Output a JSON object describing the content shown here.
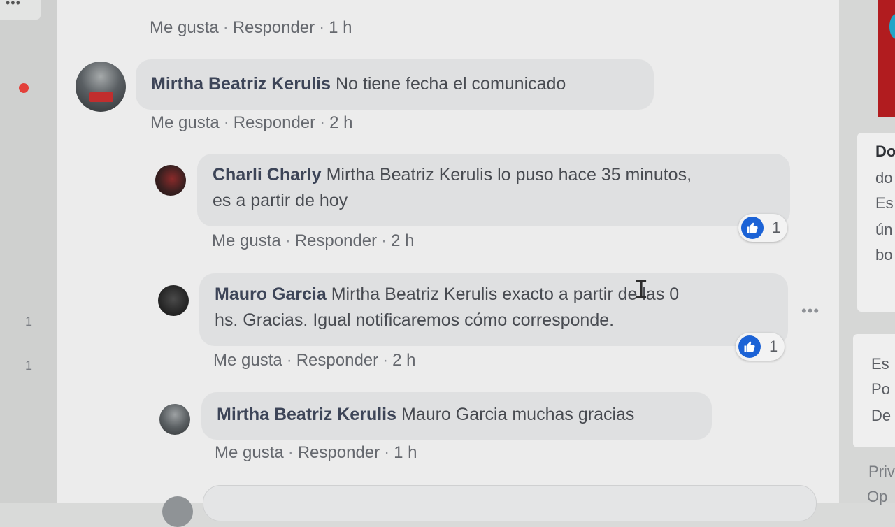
{
  "actions": {
    "like": "Me gusta",
    "reply": "Responder",
    "separator": "·"
  },
  "top_actions": {
    "time": "1 h"
  },
  "comments": [
    {
      "author": "Mirtha Beatriz Kerulis",
      "text": "No tiene fecha el comunicado",
      "time": "2 h"
    },
    {
      "author": "Charli Charly",
      "text_line1": "Mirtha Beatriz Kerulis lo puso hace 35 minutos,",
      "text_line2": "es a partir de hoy",
      "time": "2 h",
      "reaction_count": "1"
    },
    {
      "author": "Mauro Garcia",
      "text_line1": "Mirtha Beatriz Kerulis exacto a partir de las 0",
      "text_line2": "hs. Gracias. Igual notificaremos cómo corresponde.",
      "time": "2 h",
      "reaction_count": "1"
    },
    {
      "author": "Mirtha Beatriz Kerulis",
      "text": "Mauro Garcia muchas gracias",
      "time": "1 h"
    }
  ],
  "left_rail": {
    "count_1": "1",
    "count_2": "1"
  },
  "right_rail": {
    "card1_lines": [
      "Do",
      "do",
      "Es",
      "ún",
      "bo"
    ],
    "card2_lines": [
      "Es",
      "Po",
      "De"
    ],
    "footer_lines": [
      "Priv",
      "Op"
    ]
  },
  "icons": {
    "like": "thumbs-up-icon",
    "more": "more-options-icon",
    "cursor": "text-cursor-icon"
  },
  "colors": {
    "like_blue": "#1c63d6",
    "notification_red": "#e3403a",
    "author_name": "#3d4558"
  }
}
